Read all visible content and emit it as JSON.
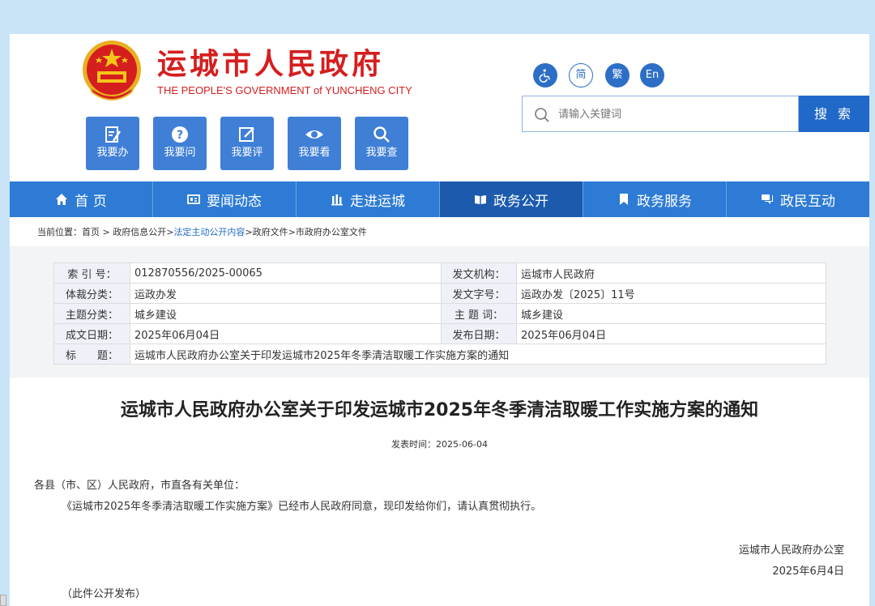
{
  "header": {
    "title": "运城市人民政府",
    "subtitle": "THE PEOPLE'S GOVERNMENT of YUNCHENG CITY"
  },
  "quick_links": [
    {
      "label": "我要办",
      "icon": "edit-doc-icon"
    },
    {
      "label": "我要问",
      "icon": "question-icon"
    },
    {
      "label": "我要评",
      "icon": "pencil-icon"
    },
    {
      "label": "我要看",
      "icon": "eye-icon"
    },
    {
      "label": "我要查",
      "icon": "search-icon"
    }
  ],
  "language": {
    "accessibility_icon": "wheelchair-icon",
    "simplified": "简",
    "traditional": "繁",
    "english": "En"
  },
  "search": {
    "placeholder": "请输入关键词",
    "button": "搜 索"
  },
  "nav": [
    {
      "label": "首 页",
      "icon": "home-icon"
    },
    {
      "label": "要闻动态",
      "icon": "news-icon"
    },
    {
      "label": "走进运城",
      "icon": "building-icon"
    },
    {
      "label": "政务公开",
      "icon": "book-icon",
      "active": true
    },
    {
      "label": "政务服务",
      "icon": "bookmark-icon"
    },
    {
      "label": "政民互动",
      "icon": "chat-icon"
    }
  ],
  "breadcrumb": {
    "prefix": "当前位置：首页 > 政府信息公开>",
    "highlight": "法定主动公开内容",
    "suffix": ">政府文件>市政府办公室文件"
  },
  "meta": {
    "index_label": "索 引 号：",
    "index_value": "012870556/2025-00065",
    "issuer_label": "发文机构：",
    "issuer_value": "运城市人民政府",
    "genre_label": "体裁分类：",
    "genre_value": "运政办发",
    "docno_label": "发文字号：",
    "docno_value": "运政办发〔2025〕11号",
    "topic_label": "主题分类：",
    "topic_value": "城乡建设",
    "keyword_label": "主 题 词：",
    "keyword_value": "城乡建设",
    "made_label": "成文日期：",
    "made_value": "2025年06月04日",
    "pub_label": "发布日期：",
    "pub_value": "2025年06月04日",
    "title_label": "标　　题：",
    "title_value": "运城市人民政府办公室关于印发运城市2025年冬季清洁取暖工作实施方案的通知"
  },
  "article": {
    "title": "运城市人民政府办公室关于印发运城市2025年冬季清洁取暖工作实施方案的通知",
    "pub_time": "发表时间：2025-06-04",
    "salutation": "各县（市、区）人民政府，市直各有关单位：",
    "paragraph": "《运城市2025年冬季清洁取暖工作实施方案》已经市人民政府同意，现印发给你们，请认真贯彻执行。",
    "signer": "运城市人民政府办公室",
    "date": "2025年6月4日",
    "note": "（此件公开发布）"
  },
  "colors": {
    "brand_red": "#d51e1e",
    "nav_blue": "#2d7bd4",
    "nav_active": "#1b5aad"
  }
}
